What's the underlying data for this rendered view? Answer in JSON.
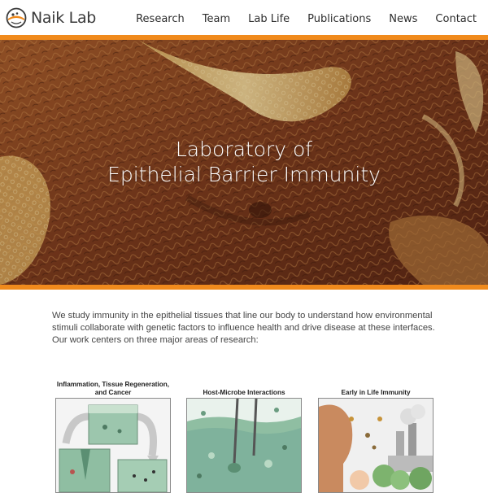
{
  "header": {
    "logo_text": "Naik Lab",
    "nav": [
      "Research",
      "Team",
      "Lab Life",
      "Publications",
      "News",
      "Contact"
    ]
  },
  "hero": {
    "title_line1": "Laboratory of",
    "title_line2": "Epithelial Barrier Immunity"
  },
  "intro": {
    "text": "We study immunity in the epithelial tissues that line our body to understand how environmental stimuli collaborate with genetic factors to influence health and drive disease at these interfaces. Our work centers on three major areas of research:"
  },
  "research_areas": [
    {
      "title": "Inflammation, Tissue Regeneration, and Cancer"
    },
    {
      "title": "Host-Microbe Interactions"
    },
    {
      "title": "Early in Life Immunity"
    }
  ],
  "colors": {
    "accent": "#f08a1c",
    "hero_dark": "#5e2b18",
    "hero_light": "#e8c681",
    "teal": "#7fb29c"
  }
}
